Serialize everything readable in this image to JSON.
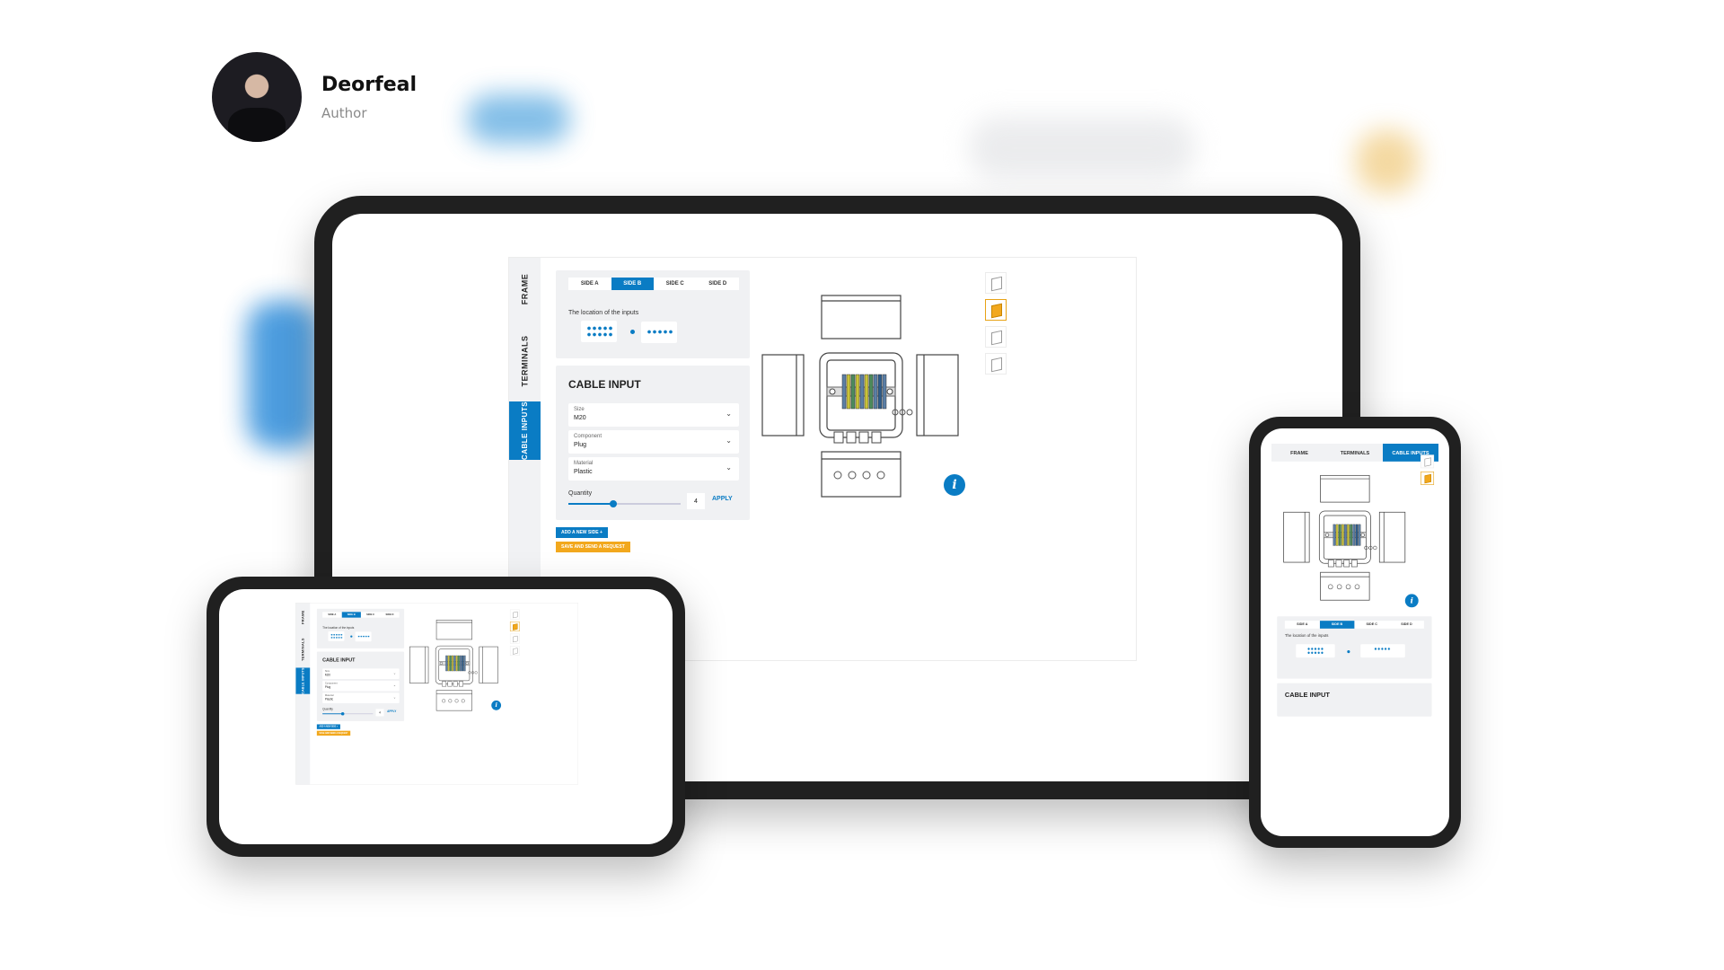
{
  "author": {
    "name": "Deorfeal",
    "role": "Author"
  },
  "configurator": {
    "tabs": [
      "FRAME",
      "TERMINALS",
      "CABLE INPUTS"
    ],
    "active_tab": "CABLE INPUTS",
    "sides": [
      "SIDE A",
      "SIDE B",
      "SIDE C",
      "SIDE D"
    ],
    "active_side": "SIDE B",
    "location_label": "The location of the inputs",
    "panel_title": "CABLE INPUT",
    "fields": [
      {
        "label": "Size",
        "value": "M20"
      },
      {
        "label": "Component",
        "value": "Plug"
      },
      {
        "label": "Material",
        "value": "Plastic"
      }
    ],
    "quantity_label": "Quantity",
    "quantity_value": "4",
    "quantity_slider_fraction": 0.4,
    "apply_label": "APPLY",
    "add_side_label": "ADD A NEW SIDE +",
    "save_label": "SAVE AND SEND A REQUEST",
    "info_glyph": "i",
    "chevron_glyph": "⌄"
  },
  "colors": {
    "accent": "#0a7cc4",
    "orange": "#f2a81d",
    "frame": "#202020",
    "panel": "#f0f1f3"
  },
  "icons": [
    "info-icon",
    "chevron-down-icon",
    "view-3d-icon"
  ]
}
